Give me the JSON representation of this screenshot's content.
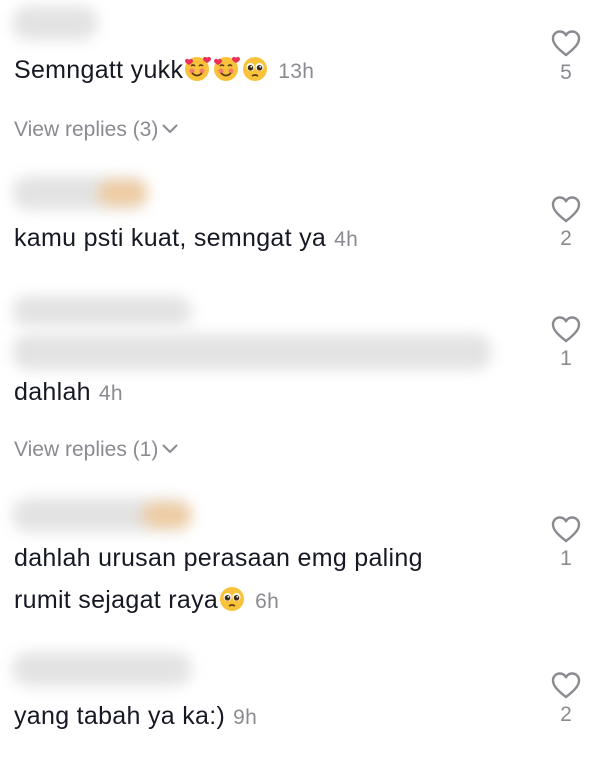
{
  "comments": [
    {
      "text": "Semngatt yukk",
      "emojis": [
        "smiling-face-with-hearts",
        "smiling-face-with-hearts",
        "pleading-face"
      ],
      "time": "13h",
      "likes": "5",
      "replies_label": "View replies (3)"
    },
    {
      "text": "kamu psti kuat, semngat ya",
      "time": "4h",
      "likes": "2"
    },
    {
      "text": "dahlah",
      "time": "4h",
      "likes": "1",
      "replies_label": "View replies (1)"
    },
    {
      "text_line1": "dahlah urusan perasaan emg paling",
      "text_line2": "rumit sejagat raya",
      "emojis": [
        "pleading-face"
      ],
      "time": "6h",
      "likes": "1"
    },
    {
      "text": "yang tabah ya ka:)",
      "time": "9h",
      "likes": "2"
    }
  ],
  "colors": {
    "text": "#161823",
    "secondary": "#8a8b91",
    "icon_stroke": "#8a8b91"
  },
  "icons": {
    "like": "heart-outline-icon",
    "expand": "chevron-down-icon"
  }
}
